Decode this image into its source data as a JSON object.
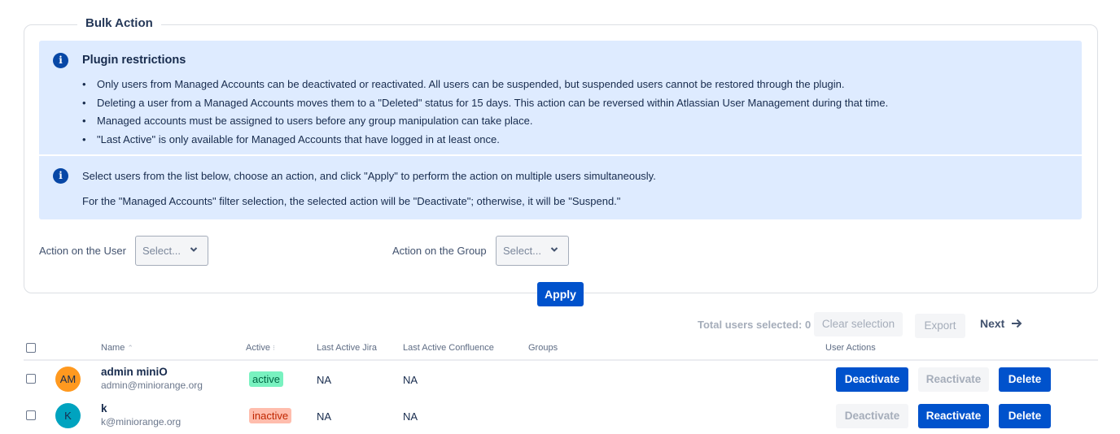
{
  "bulk_action": {
    "legend": "Bulk Action",
    "restrictions": {
      "title": "Plugin restrictions",
      "items": [
        "Only users from Managed Accounts can be deactivated or reactivated. All users can be suspended, but suspended users cannot be restored through the plugin.",
        "Deleting a user from a Managed Accounts moves them to a \"Deleted\" status for 15 days. This action can be reversed within Atlassian User Management during that time.",
        "Managed accounts must be assigned to users before any group manipulation can take place.",
        "\"Last Active\" is only available for Managed Accounts that have logged in at least once."
      ]
    },
    "instructions": {
      "line1": "Select users from the list below, choose an action, and click \"Apply\" to perform the action on multiple users simultaneously.",
      "line2": "For the \"Managed Accounts\" filter selection, the selected action will be \"Deactivate\"; otherwise, it will be \"Suspend.\""
    },
    "user_action": {
      "label": "Action on the User",
      "placeholder": "Select..."
    },
    "group_action": {
      "label": "Action on the Group",
      "placeholder": "Select..."
    },
    "apply_label": "Apply"
  },
  "toolbar": {
    "selected_text": "Total users selected: 0",
    "clear_label": "Clear selection",
    "export_label": "Export",
    "next_label": "Next"
  },
  "table": {
    "headers": {
      "name": "Name",
      "active": "Active",
      "last_jira": "Last Active Jira",
      "last_confluence": "Last Active Confluence",
      "groups": "Groups",
      "user_actions": "User Actions"
    },
    "rows": [
      {
        "initials": "AM",
        "avatar_color": "#ff991f",
        "name": "admin miniO",
        "email": "admin@miniorange.org",
        "status": "active",
        "last_jira": "NA",
        "last_confluence": "NA",
        "groups": "",
        "actions": {
          "deactivate": "Deactivate",
          "reactivate": "Reactivate",
          "delete": "Delete"
        }
      },
      {
        "initials": "K",
        "avatar_color": "#00a3bf",
        "name": "k",
        "email": "k@miniorange.org",
        "status": "inactive",
        "last_jira": "NA",
        "last_confluence": "NA",
        "groups": "",
        "actions": {
          "deactivate": "Deactivate",
          "reactivate": "Reactivate",
          "delete": "Delete"
        }
      }
    ]
  },
  "colors": {
    "primary": "#0052cc",
    "info_bg": "#deebff",
    "active_bg": "#79f2c0",
    "inactive_bg": "#ffbdad"
  }
}
